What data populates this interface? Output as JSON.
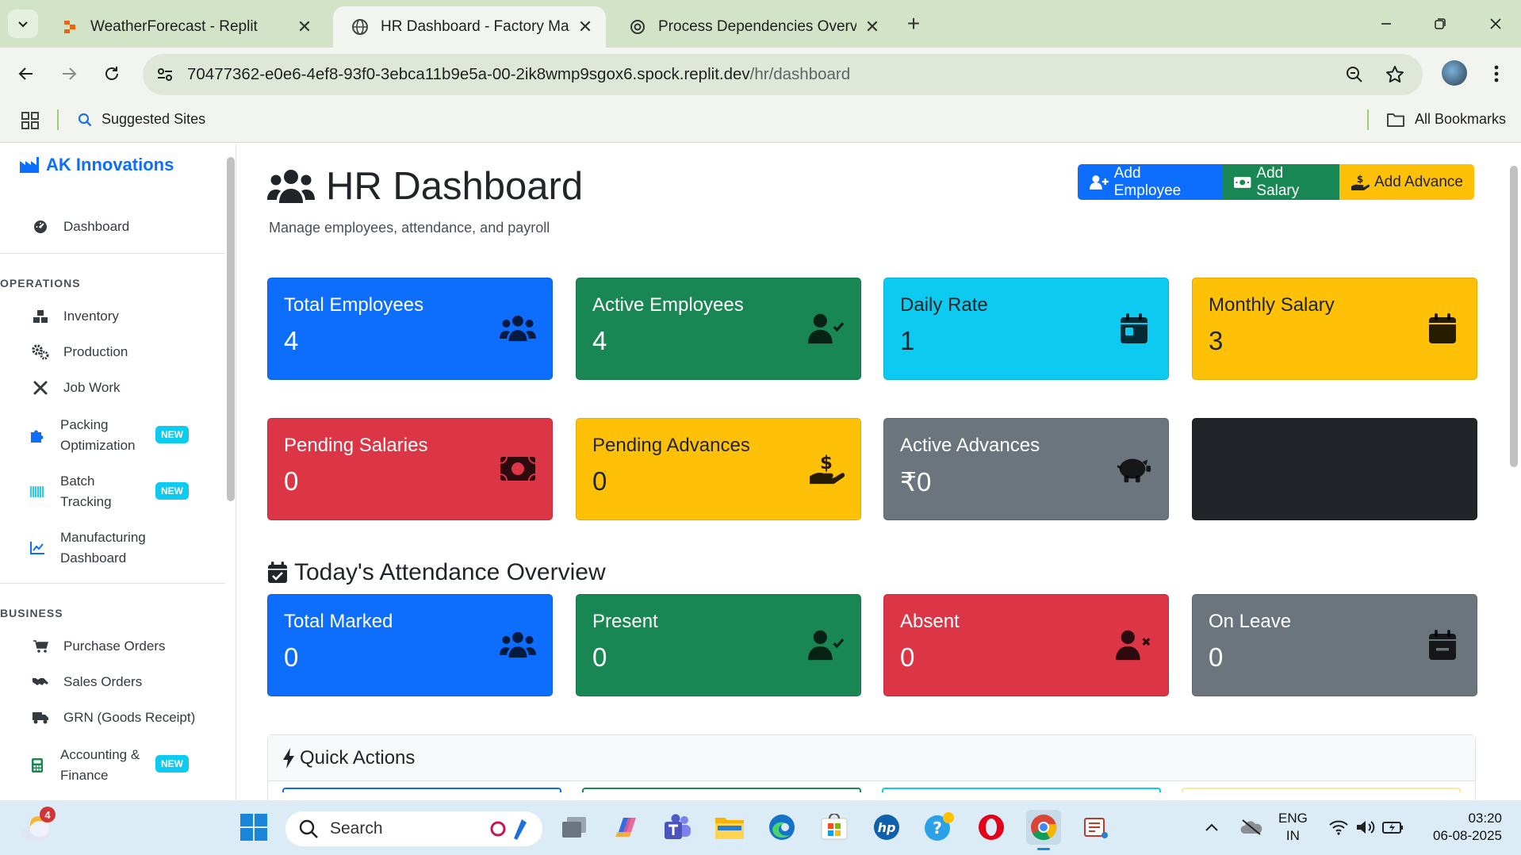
{
  "browser": {
    "tabs": [
      {
        "title": "WeatherForecast - Replit",
        "active": false
      },
      {
        "title": "HR Dashboard - Factory Manag",
        "active": true
      },
      {
        "title": "Process Dependencies Overview",
        "active": false
      }
    ],
    "url_host": "70477362-e0e6-4ef8-93f0-3ebca11b9e5a-00-2ik8wmp9sgox6.spock.replit.dev",
    "url_path": "/hr/dashboard",
    "bookmarks": {
      "suggested": "Suggested Sites",
      "all": "All Bookmarks"
    }
  },
  "sidebar": {
    "brand": "AK Innovations",
    "dashboard": "Dashboard",
    "operations_heading": "OPERATIONS",
    "operations": [
      {
        "label": "Inventory",
        "icon": "boxes-icon"
      },
      {
        "label": "Production",
        "icon": "gears-icon"
      },
      {
        "label": "Job Work",
        "icon": "tools-icon"
      },
      {
        "label": "Packing\nOptimization",
        "icon": "puzzle-icon",
        "badge": "NEW"
      },
      {
        "label": "Batch\nTracking",
        "icon": "barcode-icon",
        "badge": "NEW"
      },
      {
        "label": "Manufacturing\nDashboard",
        "icon": "chart-line-icon"
      }
    ],
    "business_heading": "BUSINESS",
    "business": [
      {
        "label": "Purchase Orders",
        "icon": "cart-icon"
      },
      {
        "label": "Sales Orders",
        "icon": "handshake-icon"
      },
      {
        "label": "GRN (Goods Receipt)",
        "icon": "truck-icon"
      },
      {
        "label": "Accounting &\nFinance",
        "icon": "calculator-icon",
        "badge": "NEW"
      }
    ]
  },
  "header": {
    "title": "HR Dashboard",
    "subtitle": "Manage employees, attendance, and payroll",
    "buttons": {
      "add_employee": "Add Employee",
      "add_salary": "Add Salary",
      "add_advance": "Add Advance"
    }
  },
  "stats": [
    {
      "title": "Total Employees",
      "value": "4",
      "color": "#0d6efd",
      "icon": "users-icon"
    },
    {
      "title": "Active Employees",
      "value": "4",
      "color": "#198754",
      "icon": "user-check-icon"
    },
    {
      "title": "Daily Rate",
      "value": "1",
      "color": "#0dcaf0",
      "icon": "calendar-day-icon"
    },
    {
      "title": "Monthly Salary",
      "value": "3",
      "color": "#ffc107",
      "icon": "calendar-icon"
    },
    {
      "title": "Pending Salaries",
      "value": "0",
      "color": "#dc3545",
      "icon": "money-bill-icon"
    },
    {
      "title": "Pending Advances",
      "value": "0",
      "color": "#ffc107",
      "icon": "hand-holding-dollar-icon"
    },
    {
      "title": "Active Advances",
      "value": "₹0",
      "color": "#6c757d",
      "icon": "piggy-bank-icon"
    },
    {
      "title": "",
      "value": "",
      "color": "#212529",
      "icon": ""
    }
  ],
  "attendance": {
    "heading": "Today's Attendance Overview",
    "cards": [
      {
        "title": "Total Marked",
        "value": "0",
        "color": "#0d6efd",
        "icon": "users-icon"
      },
      {
        "title": "Present",
        "value": "0",
        "color": "#198754",
        "icon": "user-check-icon"
      },
      {
        "title": "Absent",
        "value": "0",
        "color": "#dc3545",
        "icon": "user-xmark-icon"
      },
      {
        "title": "On Leave",
        "value": "0",
        "color": "#6c757d",
        "icon": "calendar-minus-icon"
      }
    ]
  },
  "quick_actions": {
    "heading": "Quick Actions"
  },
  "taskbar": {
    "search": "Search",
    "weather_badge": "4",
    "lang": "ENG",
    "region": "IN",
    "time": "03:20",
    "date": "06-08-2025"
  }
}
